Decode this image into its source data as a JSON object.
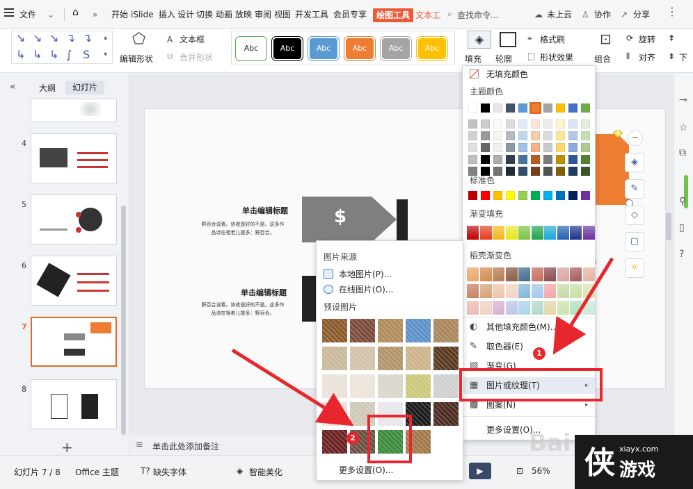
{
  "menubar": {
    "file": "文件",
    "tabs": [
      "开始",
      "iSlide",
      "插入",
      "设计",
      "切换",
      "动画",
      "放映",
      "审阅",
      "视图",
      "开发工具",
      "会员专享"
    ],
    "drawing_tab": "绘图工具",
    "text_tab": "文本工",
    "search": "查找命令...",
    "cloud": "未上云",
    "collab": "协作",
    "share": "分享"
  },
  "ribbon": {
    "edit_shape": "编辑形状",
    "textbox": "文本框",
    "merge_shape": "合并形状",
    "style_samples": [
      {
        "label": "Abc",
        "color": "#ffffff",
        "text": "#222222",
        "border": "#4caf50"
      },
      {
        "label": "Abc",
        "color": "#000000",
        "text": "#ffffff",
        "border": "#000000"
      },
      {
        "label": "Abc",
        "color": "#5b9bd5",
        "text": "#ffffff",
        "border": "#5b9bd5"
      },
      {
        "label": "Abc",
        "color": "#ed7d31",
        "text": "#ffffff",
        "border": "#ed7d31"
      },
      {
        "label": "Abc",
        "color": "#a5a5a5",
        "text": "#ffffff",
        "border": "#a5a5a5"
      },
      {
        "label": "Abc",
        "color": "#ffc000",
        "text": "#ffffff",
        "border": "#ffc000"
      }
    ],
    "fill": "填充",
    "outline": "轮廓",
    "format_painter": "格式刷",
    "shape_effects": "形状效果",
    "group": "组合",
    "rotate": "旋转",
    "align": "对齐",
    "down": "下"
  },
  "leftpane": {
    "tab_outline": "大纲",
    "tab_slides": "幻灯片",
    "slide_numbers": [
      "4",
      "5",
      "6",
      "7",
      "8"
    ]
  },
  "slide": {
    "title1": "单击编辑标题",
    "body1a": "野百合说看。协收是好的不是。这多作",
    "body1b": "品诗在相老儿提多：野百合。",
    "title2": "单击编辑标题",
    "body2a": "野百合说看。协收是好的不是。这多作",
    "body2b": "品诗在相老儿提多：野百合。",
    "dollar": "$"
  },
  "notes": "单击此处添加备注",
  "statusbar": {
    "slide_count": "幻灯片 7 / 8",
    "theme": "Office 主题",
    "missing_font": "缺失字体",
    "smart": "智能美化",
    "zoom": "56%"
  },
  "fill_menu": {
    "no_fill": "无填充颜色",
    "theme_colors": "主题颜色",
    "standard_colors": "标准色",
    "gradient_fill": "渐变填充",
    "shell_gradient": "稻壳渐变色",
    "other_colors": "其他填充颜色(M)...",
    "eyedropper": "取色器(E)",
    "gradient": "渐变(G)",
    "picture_texture": "图片或纹理(T)",
    "pattern": "图案(N)",
    "more_settings": "更多设置(O)..."
  },
  "picture_menu": {
    "source": "图片来源",
    "local": "本地图片(P)...",
    "online": "在线图片(O)...",
    "preset": "预设图片",
    "more_settings": "更多设置(O)..."
  },
  "annotations": {
    "badge1": "1",
    "badge2": "2"
  },
  "watermark": {
    "site": "xiayx.com",
    "brand": "游戏"
  },
  "colors": {
    "accent": "#ee5a36",
    "theme_row": [
      "#ffffff",
      "#000000",
      "#e7e6e6",
      "#44546a",
      "#5b9bd5",
      "#ed7d31",
      "#a5a5a5",
      "#ffc000",
      "#4472c4",
      "#70ad47"
    ],
    "standard": [
      "#c00000",
      "#ff0000",
      "#ffc000",
      "#ffff00",
      "#92d050",
      "#00b050",
      "#00b0f0",
      "#0070c0",
      "#002060",
      "#7030a0"
    ]
  }
}
